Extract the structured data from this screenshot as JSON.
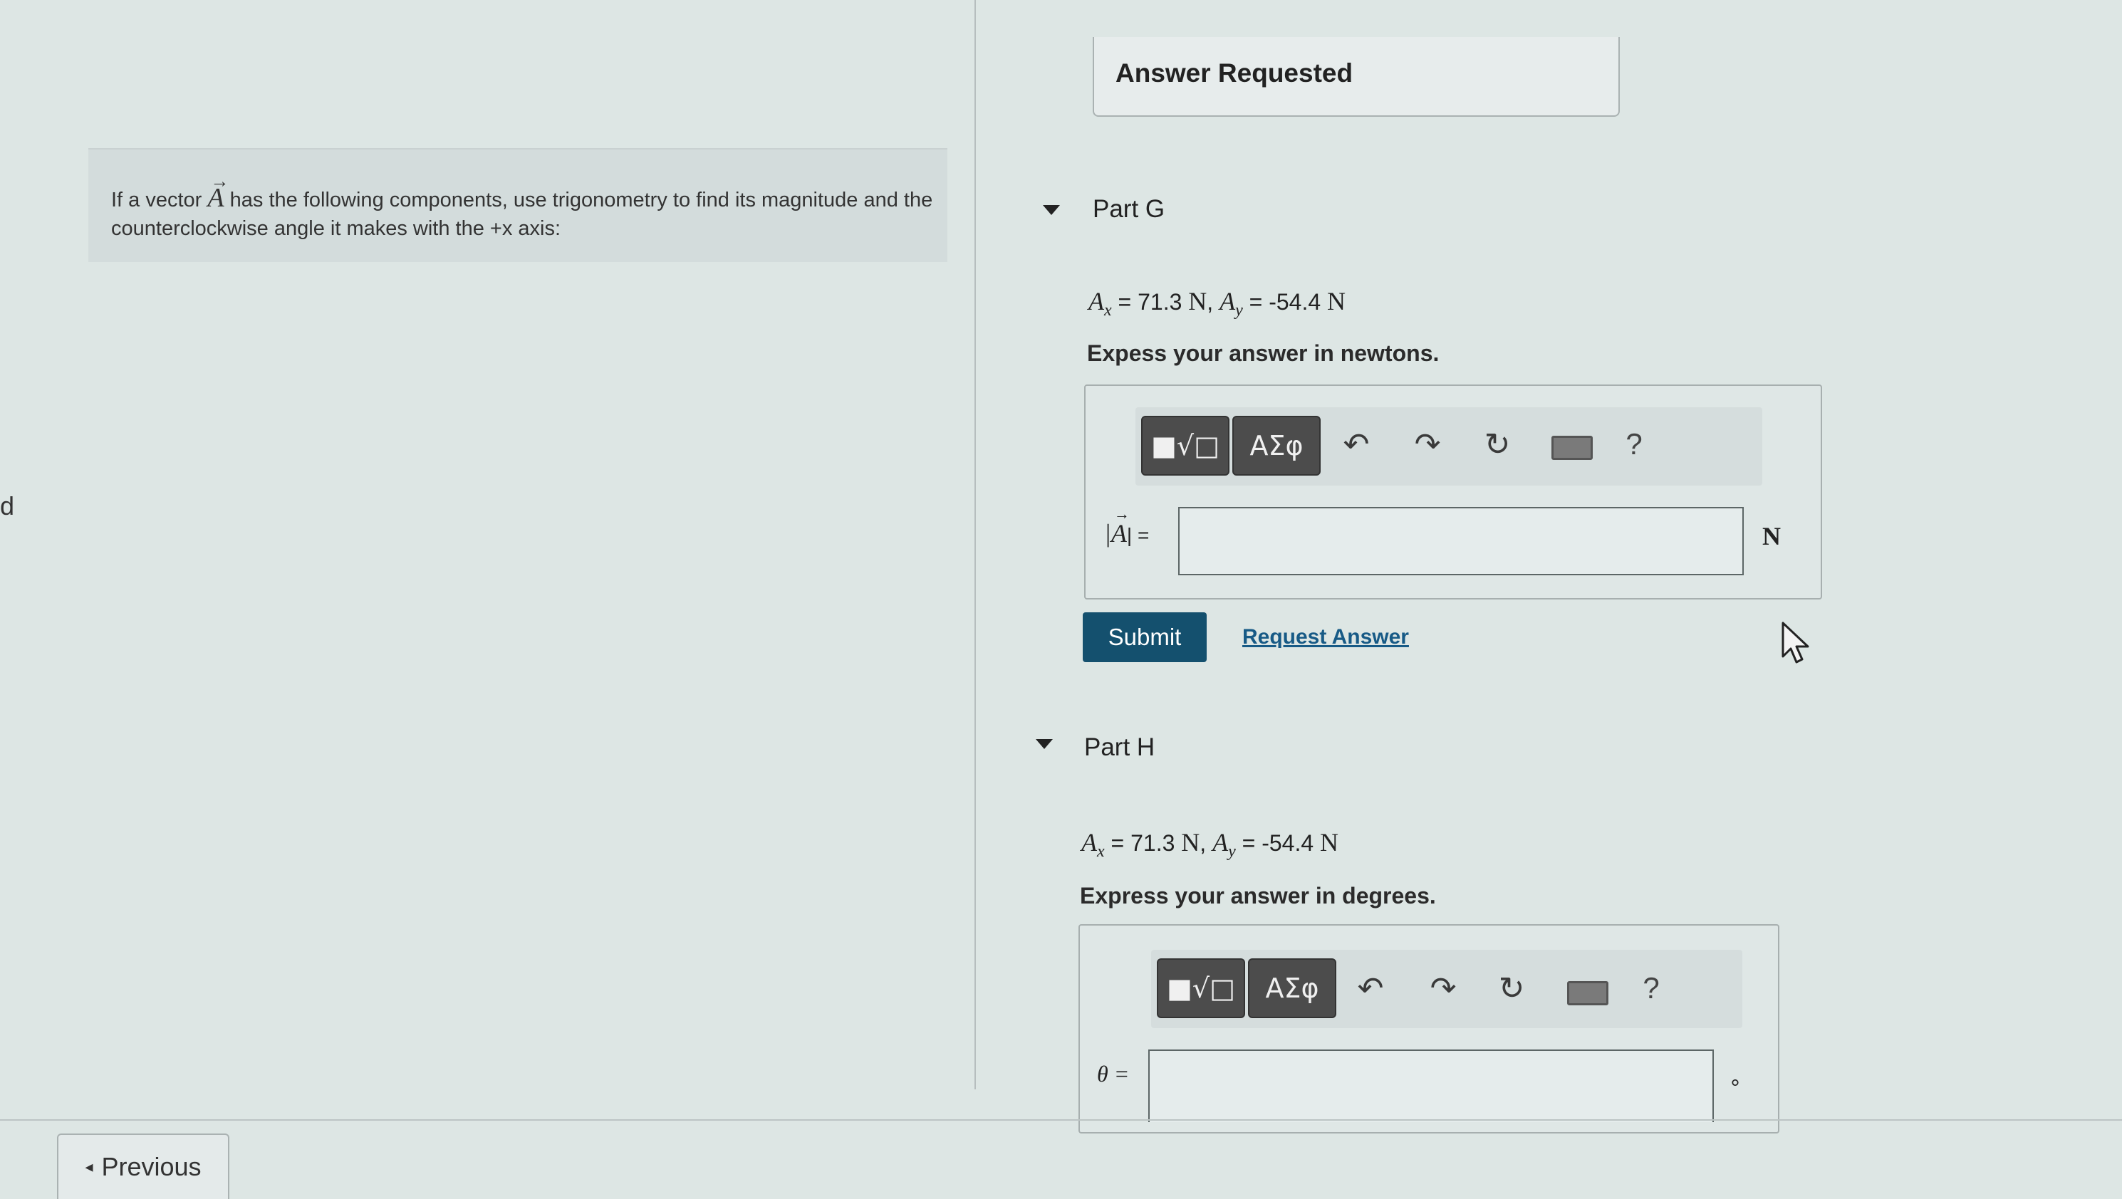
{
  "edge": {
    "letter": "d"
  },
  "problem": {
    "text_before": "If a vector ",
    "vector_symbol": "A",
    "text_after": " has the following components, use trigonometry to find its magnitude and the counterclockwise angle it makes with the +x axis:"
  },
  "answer_requested": {
    "label": "Answer Requested"
  },
  "part_g": {
    "label": "Part G",
    "ax_label": "A",
    "ax_sub": "x",
    "ax_value": " = 71.3 ",
    "ax_unit": "N",
    "ay_label": "A",
    "ay_sub": "y",
    "ay_value": " = -54.4 ",
    "ay_unit": "N",
    "instruction": "Expess your answer in newtons.",
    "field_label_left": "|",
    "field_vector": "A",
    "field_label_right": "| =",
    "field_value": "",
    "unit": "N"
  },
  "part_h": {
    "label": "Part H",
    "ax_label": "A",
    "ax_sub": "x",
    "ax_value": " = 71.3 ",
    "ax_unit": "N",
    "ay_label": "A",
    "ay_sub": "y",
    "ay_value": " = -54.4 ",
    "ay_unit": "N",
    "instruction": "Express your answer in degrees.",
    "field_label": "θ =",
    "field_value": "",
    "unit": "°"
  },
  "toolbar": {
    "templates_label": "■√□",
    "greek_label": "ΑΣφ",
    "undo_icon": "undo-icon",
    "redo_icon": "redo-icon",
    "reset_icon": "reset-icon",
    "keyboard_icon": "keyboard-icon",
    "help_label": "?"
  },
  "actions": {
    "submit_label": "Submit",
    "request_answer_label": "Request Answer"
  },
  "navigation": {
    "previous_label": "Previous",
    "previous_glyph": "◂"
  },
  "colors": {
    "submit_bg": "#14506e",
    "link": "#175a86",
    "toolbar_button": "#4c4c4c"
  }
}
